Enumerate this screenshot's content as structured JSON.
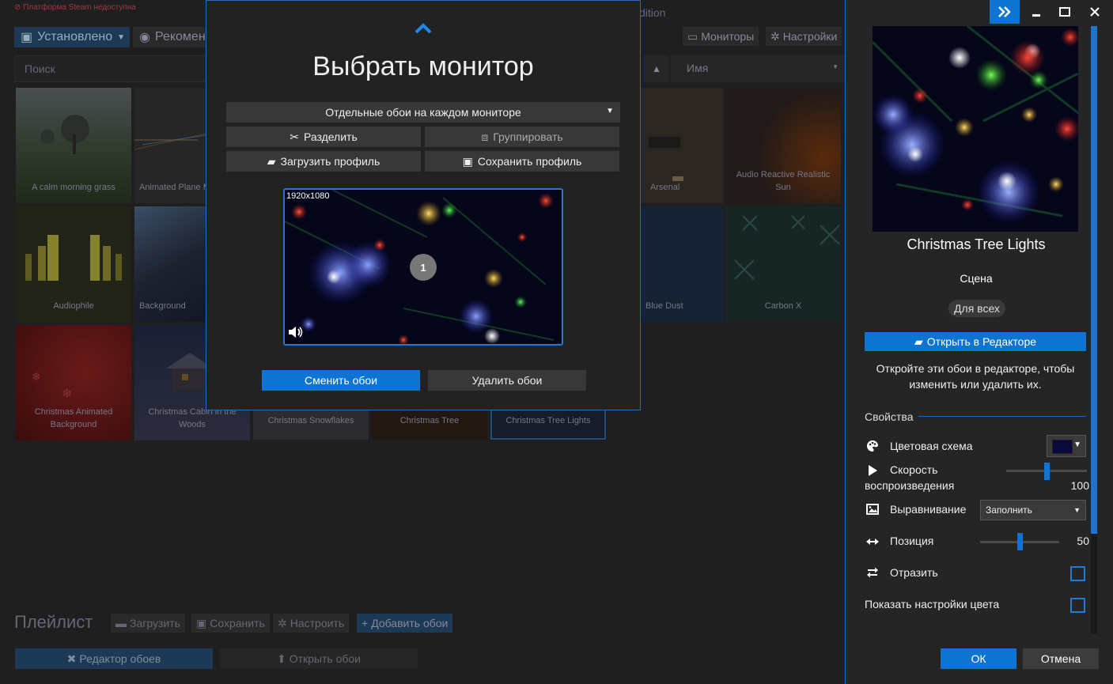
{
  "background": {
    "warning_text": "Платформа Steam недоступна",
    "edition_text": "dition",
    "tabs": {
      "installed": "Установлено",
      "recommended": "Рекомен"
    },
    "search_placeholder": "Поиск",
    "sort_field": "Имя",
    "top_buttons": {
      "monitors": "Мониторы",
      "settings": "Настройки"
    },
    "tiles": [
      "A calm morning grass",
      "Animated Plane M",
      "Audiophile",
      "Background",
      "Christmas Animated Background",
      "Christmas Cabin in the Woods",
      "Christmas Snowflakes",
      "Christmas Tree",
      "Christmas Tree Lights",
      "Arsenal",
      "Audio Reactive Realistic Sun",
      "Blue Dust",
      "Carbon X"
    ],
    "playlist": {
      "title": "Плейлист",
      "load": "Загрузить",
      "save": "Сохранить",
      "configure": "Настроить",
      "add": "Добавить обои"
    },
    "bottom": {
      "editor": "Редактор обоев",
      "open": "Открыть обои"
    }
  },
  "dialog": {
    "title": "Выбрать монитор",
    "mode_select": "Отдельные обои на каждом мониторе",
    "split": "Разделить",
    "group": "Группировать",
    "load_profile": "Загрузить профиль",
    "save_profile": "Сохранить профиль",
    "monitor_resolution": "1920x1080",
    "monitor_number": "1",
    "change": "Сменить обои",
    "remove": "Удалить обои"
  },
  "panel": {
    "title": "Christmas Tree Lights",
    "type": "Сцена",
    "rating": "Для всех",
    "open_editor": "Открыть в Редакторе",
    "editor_hint": "Откройте эти обои в редакторе, чтобы изменить или удалить их.",
    "properties_label": "Свойства",
    "color_scheme": "Цветовая схема",
    "color_scheme_value": "#0a0a3a",
    "playback_speed_1": "Скорость",
    "playback_speed_2": "воспроизведения",
    "playback_speed_value": "100",
    "playback_speed_fraction": 0.5,
    "alignment": "Выравнивание",
    "alignment_value": "Заполнить",
    "position": "Позиция",
    "position_value": "50",
    "position_fraction": 0.5,
    "mirror": "Отразить",
    "mirror_checked": false,
    "show_color_settings": "Показать настройки цвета",
    "show_color_checked": false,
    "ok": "ОК",
    "cancel": "Отмена"
  },
  "colors": {
    "accent": "#0e74d2",
    "border_accent": "#1e6ac0"
  }
}
